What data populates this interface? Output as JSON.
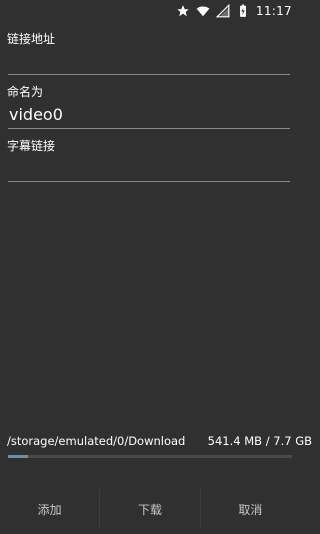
{
  "status_bar": {
    "time": "11:17",
    "icons": [
      "star-icon",
      "wifi-icon",
      "signal-icon",
      "battery-charging-icon"
    ]
  },
  "form": {
    "link_label": "链接地址",
    "link_value": "",
    "name_label": "命名为",
    "name_value": "video0",
    "subtitle_label": "字幕链接",
    "subtitle_value": ""
  },
  "storage": {
    "path": "/storage/emulated/0/Download",
    "size": "541.4 MB / 7.7 GB",
    "used_fraction": 0.07
  },
  "actions": {
    "add_label": "添加",
    "download_label": "下载",
    "cancel_label": "取消"
  },
  "colors": {
    "background": "#303030",
    "progress": "#6f8fa6",
    "underline": "#8a8a8a"
  }
}
